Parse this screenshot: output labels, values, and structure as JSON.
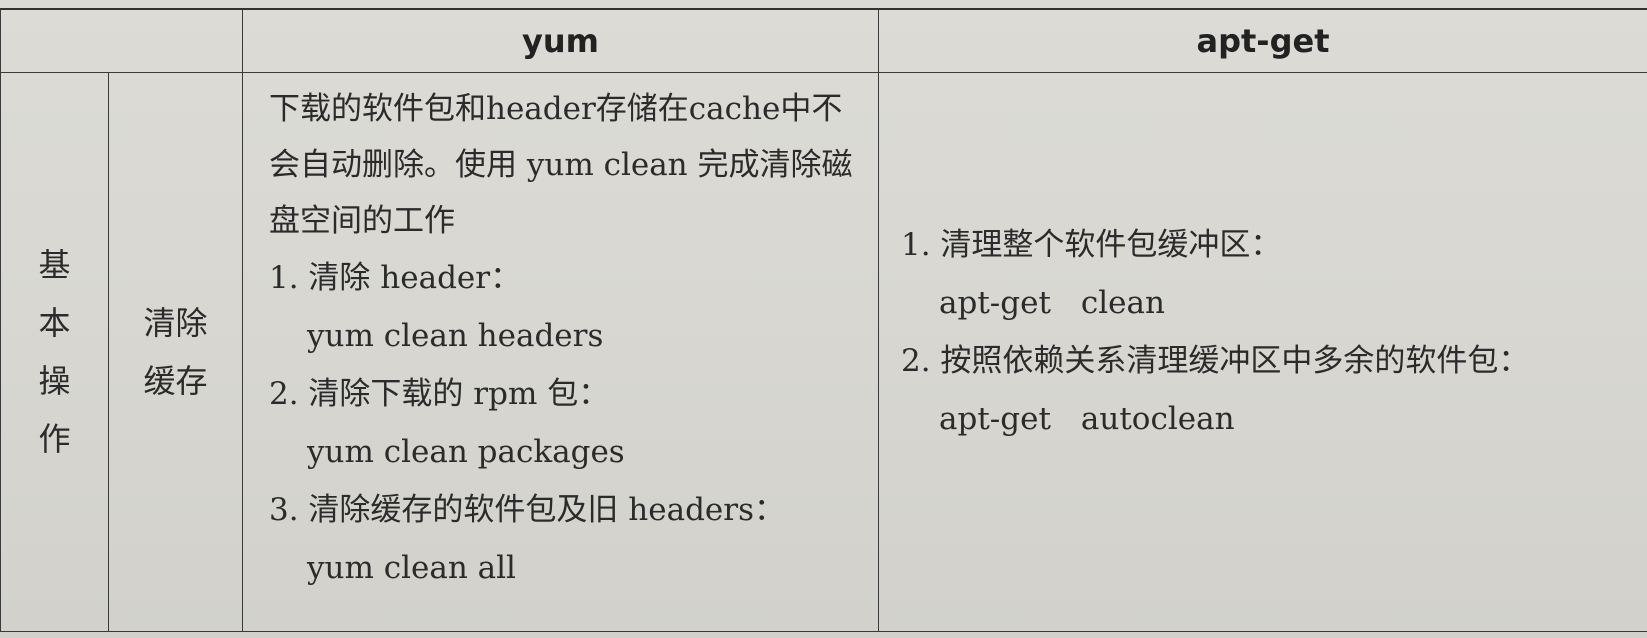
{
  "header": {
    "col1": "",
    "yum": "yum",
    "apt": "apt-get"
  },
  "row": {
    "category_chars": [
      "基",
      "本",
      "操",
      "作"
    ],
    "sub_lines": [
      "清除",
      "缓存"
    ],
    "yum": {
      "description": "下载的软件包和header存储在cache中不会自动删除。使用 yum clean 完成清除磁盘空间的工作",
      "items": [
        {
          "label": "1. 清除 header：",
          "command": "yum clean headers"
        },
        {
          "label": "2. 清除下载的 rpm 包：",
          "command": "yum clean packages"
        },
        {
          "label": "3. 清除缓存的软件包及旧 headers：",
          "command": "yum clean all"
        }
      ]
    },
    "apt": {
      "items": [
        {
          "label": "1. 清理整个软件包缓冲区：",
          "command_a": "apt-get",
          "command_b": "clean"
        },
        {
          "label": "2. 按照依赖关系清理缓冲区中多余的软件包：",
          "command_a": "apt-get",
          "command_b": "autoclean"
        }
      ]
    }
  }
}
